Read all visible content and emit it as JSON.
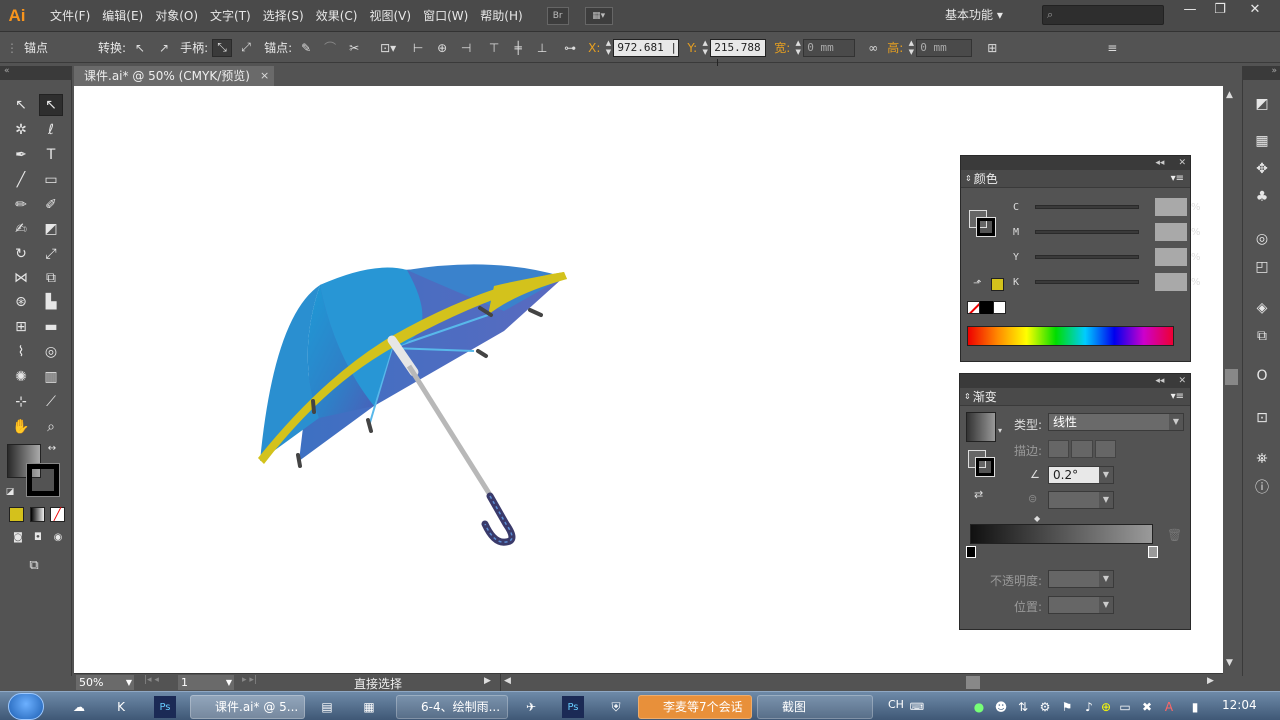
{
  "app": {
    "logo": "Ai"
  },
  "menubar": {
    "items": [
      "文件(F)",
      "编辑(E)",
      "对象(O)",
      "文字(T)",
      "选择(S)",
      "效果(C)",
      "视图(V)",
      "窗口(W)",
      "帮助(H)"
    ],
    "bridge_button": "Br",
    "workspace": "基本功能",
    "search_placeholder": ""
  },
  "window_controls": {
    "minimize": "—",
    "restore": "❐",
    "close": "✕"
  },
  "control_bar": {
    "anchor_label": "锚点",
    "convert_label": "转换:",
    "handle_label": "手柄:",
    "anchor2_label": "锚点:",
    "x_label": "X:",
    "x_value": "972.681 |",
    "y_label": "Y:",
    "y_value": "215.788 |",
    "w_label": "宽:",
    "w_value": "0 mm",
    "h_label": "高:",
    "h_value": "0 mm"
  },
  "document": {
    "tab_title": "课件.ai* @ 50% (CMYK/预览)",
    "close": "×"
  },
  "color_panel": {
    "title": "颜色",
    "sliders": [
      {
        "letter": "C",
        "unit": "%"
      },
      {
        "letter": "M",
        "unit": "%"
      },
      {
        "letter": "Y",
        "unit": "%"
      },
      {
        "letter": "K",
        "unit": "%"
      }
    ],
    "fill_color": "#d4c11c"
  },
  "gradient_panel": {
    "title": "渐变",
    "type_label": "类型:",
    "type_value": "线性",
    "stroke_label": "描边:",
    "angle_value": "0.2°",
    "opacity_label": "不透明度:",
    "position_label": "位置:"
  },
  "statusbar": {
    "zoom": "50%",
    "page": "1",
    "tool_name": "直接选择"
  },
  "taskbar": {
    "items": [
      {
        "label": "课件.ai* @ 5..."
      },
      {
        "label": "6-4、绘制雨..."
      },
      {
        "label": "李麦等7个会话"
      },
      {
        "label": "截图"
      }
    ],
    "ime": "CH",
    "clock": "12:04"
  },
  "colors": {
    "umbrella_blue": "#2a8fd0",
    "umbrella_stripe": "#d3c21c",
    "accent_orange": "#e8a020"
  }
}
